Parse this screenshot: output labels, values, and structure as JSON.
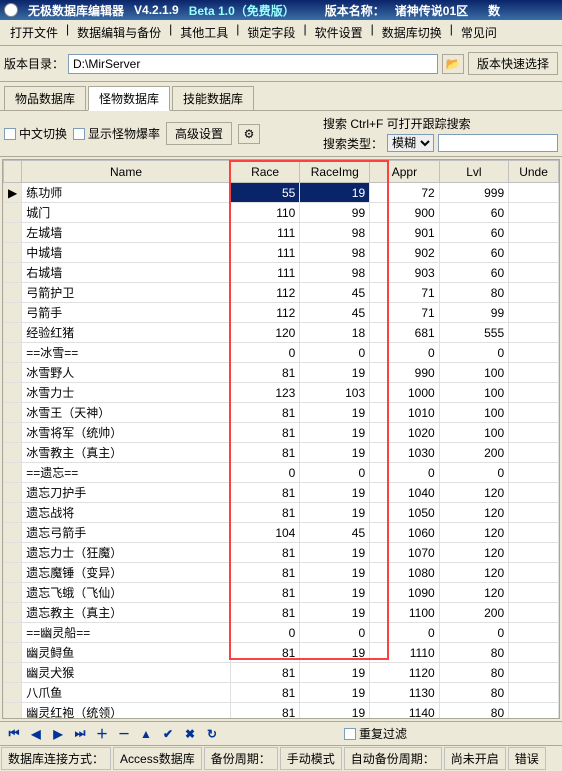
{
  "title": {
    "app": "无极数据库编辑器",
    "ver": "V4.2.1.9",
    "beta": "Beta 1.0（免费版）",
    "namelabel": "版本名称：",
    "servername": "诸神传说01区",
    "extra": "数"
  },
  "menu": [
    "打开文件",
    "数据编辑与备份",
    "其他工具",
    "锁定字段",
    "软件设置",
    "数据库切换",
    "常见问"
  ],
  "path": {
    "label": "版本目录：",
    "value": "D:\\MirServer",
    "btn": "版本快速选择"
  },
  "tabs": [
    "物品数据库",
    "怪物数据库",
    "技能数据库"
  ],
  "filter": {
    "cn": "中文切换",
    "drop": "显示怪物爆率",
    "adv": "高级设置",
    "hint": "搜索 Ctrl+F 可打开跟踪搜索",
    "typelabel": "搜索类型：",
    "type": "模糊"
  },
  "cols": [
    "",
    "Name",
    "Race",
    "RaceImg",
    "Appr",
    "Lvl",
    "Unde"
  ],
  "rows": [
    [
      "▶",
      "练功师",
      "55",
      "19",
      "72",
      "999",
      ""
    ],
    [
      "",
      "城门",
      "110",
      "99",
      "900",
      "60",
      ""
    ],
    [
      "",
      "左城墙",
      "111",
      "98",
      "901",
      "60",
      ""
    ],
    [
      "",
      "中城墙",
      "111",
      "98",
      "902",
      "60",
      ""
    ],
    [
      "",
      "右城墙",
      "111",
      "98",
      "903",
      "60",
      ""
    ],
    [
      "",
      "弓箭护卫",
      "112",
      "45",
      "71",
      "80",
      ""
    ],
    [
      "",
      "弓箭手",
      "112",
      "45",
      "71",
      "99",
      ""
    ],
    [
      "",
      "经验红猪",
      "120",
      "18",
      "681",
      "555",
      ""
    ],
    [
      "",
      "==冰雪==",
      "0",
      "0",
      "0",
      "0",
      ""
    ],
    [
      "",
      "冰雪野人",
      "81",
      "19",
      "990",
      "100",
      ""
    ],
    [
      "",
      "冰雪力士",
      "123",
      "103",
      "1000",
      "100",
      ""
    ],
    [
      "",
      "冰雪王（天神）",
      "81",
      "19",
      "1010",
      "100",
      ""
    ],
    [
      "",
      "冰雪将军（统帅）",
      "81",
      "19",
      "1020",
      "100",
      ""
    ],
    [
      "",
      "冰雪教主（真主）",
      "81",
      "19",
      "1030",
      "200",
      ""
    ],
    [
      "",
      "==遗忘==",
      "0",
      "0",
      "0",
      "0",
      ""
    ],
    [
      "",
      "遗忘刀护手",
      "81",
      "19",
      "1040",
      "120",
      ""
    ],
    [
      "",
      "遗忘战将",
      "81",
      "19",
      "1050",
      "120",
      ""
    ],
    [
      "",
      "遗忘弓箭手",
      "104",
      "45",
      "1060",
      "120",
      ""
    ],
    [
      "",
      "遗忘力士（狂魔）",
      "81",
      "19",
      "1070",
      "120",
      ""
    ],
    [
      "",
      "遗忘魔锤（变异）",
      "81",
      "19",
      "1080",
      "120",
      ""
    ],
    [
      "",
      "遗忘飞蛾（飞仙）",
      "81",
      "19",
      "1090",
      "120",
      ""
    ],
    [
      "",
      "遗忘教主（真主）",
      "81",
      "19",
      "1100",
      "200",
      ""
    ],
    [
      "",
      "==幽灵船==",
      "0",
      "0",
      "0",
      "0",
      ""
    ],
    [
      "",
      "幽灵鲟鱼",
      "81",
      "19",
      "1110",
      "80",
      ""
    ],
    [
      "",
      "幽灵犬猴",
      "81",
      "19",
      "1120",
      "80",
      ""
    ],
    [
      "",
      "八爪鱼",
      "81",
      "19",
      "1130",
      "80",
      ""
    ],
    [
      "",
      "幽灵红袍（统领）",
      "81",
      "19",
      "1140",
      "80",
      ""
    ],
    [
      "",
      "",
      "",
      "",
      "",
      "",
      ""
    ],
    [
      "",
      "",
      "",
      "",
      "",
      "",
      ""
    ],
    [
      "",
      "",
      "",
      "",
      "",
      "",
      ""
    ]
  ],
  "nav": {
    "repeat": "重复过滤"
  },
  "status": {
    "connlabel": "数据库连接方式：",
    "conn": "Access数据库",
    "backup": "备份周期：",
    "mode": "手动模式",
    "auto": "自动备份周期：",
    "open": "尚未开启",
    "err": "错误"
  }
}
